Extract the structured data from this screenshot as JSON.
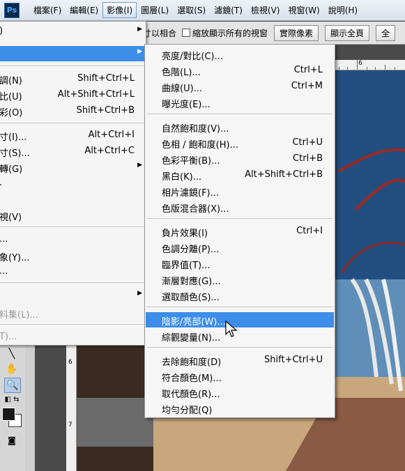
{
  "app": {
    "logo": "Ps"
  },
  "menubar": {
    "items": [
      {
        "label": "檔案(F)"
      },
      {
        "label": "編輯(E)"
      },
      {
        "label": "影像(I)",
        "active": true
      },
      {
        "label": "圖層(L)"
      },
      {
        "label": "選取(S)"
      },
      {
        "label": "濾鏡(T)"
      },
      {
        "label": "檢視(V)"
      },
      {
        "label": "視窗(W)"
      },
      {
        "label": "說明(H)"
      }
    ]
  },
  "options_bar": {
    "fit_text": "寸以相合",
    "zoom_all_label": "縮放顯示所有的視窗",
    "actual_pixels_button": "實際像素",
    "fit_screen_button": "顯示全頁",
    "extra_button": "全"
  },
  "ruler": {
    "top_label": "6",
    "left_labels": [
      "6",
      "7"
    ]
  },
  "parent_menu": {
    "items": [
      {
        "label": ")",
        "submenu": true
      },
      {
        "label": "",
        "submenu": true,
        "highlighted": true
      },
      {
        "label": "調(N)",
        "shortcut": "Shift+Ctrl+L"
      },
      {
        "label": "比(U)",
        "shortcut": "Alt+Shift+Ctrl+L"
      },
      {
        "label": "彩(O)",
        "shortcut": "Shift+Ctrl+B"
      },
      {
        "label": "寸(I)...",
        "shortcut": "Alt+Ctrl+I"
      },
      {
        "label": "寸(S)...",
        "shortcut": "Alt+Ctrl+C"
      },
      {
        "label": "轉(G)",
        "submenu": true
      },
      {
        "label": "."
      },
      {
        "label": "視(V)"
      },
      {
        "label": "..."
      },
      {
        "label": "象(Y)..."
      },
      {
        "label": "..."
      },
      {
        "label": "",
        "submenu": true
      },
      {
        "label": "料集(L)...",
        "disabled": true
      },
      {
        "label": "T)...",
        "disabled": true
      }
    ]
  },
  "submenu": {
    "items": [
      {
        "label": "亮度/對比(C)...",
        "shortcut": ""
      },
      {
        "label": "色階(L)...",
        "shortcut": "Ctrl+L"
      },
      {
        "label": "曲線(U)...",
        "shortcut": "Ctrl+M"
      },
      {
        "label": "曝光度(E)...",
        "shortcut": ""
      },
      {
        "label": "自然飽和度(V)...",
        "shortcut": ""
      },
      {
        "label": "色相 / 飽和度(H)...",
        "shortcut": "Ctrl+U"
      },
      {
        "label": "色彩平衡(B)...",
        "shortcut": "Ctrl+B"
      },
      {
        "label": "黑白(K)...",
        "shortcut": "Alt+Shift+Ctrl+B"
      },
      {
        "label": "相片濾鏡(F)...",
        "shortcut": ""
      },
      {
        "label": "色版混合器(X)...",
        "shortcut": ""
      },
      {
        "label": "負片效果(I)",
        "shortcut": "Ctrl+I"
      },
      {
        "label": "色調分離(P)...",
        "shortcut": ""
      },
      {
        "label": "臨界值(T)...",
        "shortcut": ""
      },
      {
        "label": "漸層對應(G)...",
        "shortcut": ""
      },
      {
        "label": "選取顏色(S)...",
        "shortcut": ""
      },
      {
        "label": "陰影/亮部(W)...",
        "shortcut": "",
        "highlighted": true
      },
      {
        "label": "綜觀變量(N)...",
        "shortcut": ""
      },
      {
        "label": "去除飽和度(D)",
        "shortcut": "Shift+Ctrl+U"
      },
      {
        "label": "符合顏色(M)...",
        "shortcut": ""
      },
      {
        "label": "取代顏色(R)...",
        "shortcut": ""
      },
      {
        "label": "均勻分配(Q)",
        "shortcut": ""
      }
    ]
  },
  "icons": {
    "hand_tool": "hand-icon",
    "zoom_tool": "zoom-icon",
    "pointer": "arrow-cursor-icon"
  },
  "colors": {
    "highlight": "#3d8ee9",
    "menu_background": "#f6f6f6"
  }
}
